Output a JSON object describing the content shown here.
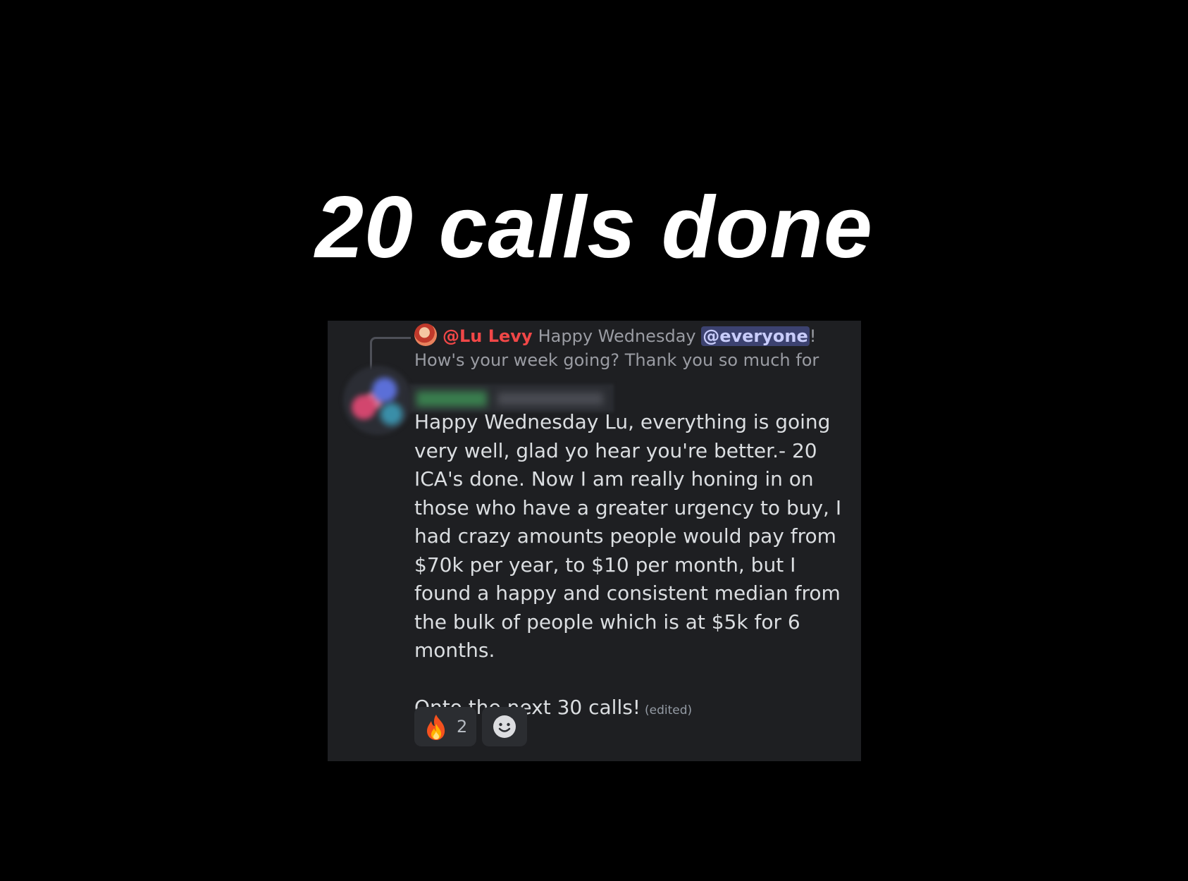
{
  "headline": "20 calls done",
  "reply": {
    "author": "@Lu Levy",
    "text_before_mention": "Happy Wednesday ",
    "mention": "@everyone",
    "text_after_mention": "! How's your week going?   Thank you so much for all the ...",
    "author_color": "#f04747"
  },
  "message": {
    "author_name_blurred": true,
    "body": "Happy Wednesday Lu, everything is going very well, glad yo hear you're better.- 20 ICA's done. Now I am really honing in on those who have a greater urgency to buy, I had crazy amounts people would pay from $70k per year, to $10 per month, but I found a happy and consistent median from the bulk of people which is at $5k for 6 months.",
    "closing": "Onto the next 30 calls!",
    "edited_label": "(edited)"
  },
  "reactions": [
    {
      "icon": "fire-icon",
      "count": "2"
    }
  ],
  "add_reaction_icon": "smiley-icon",
  "colors": {
    "background": "#000000",
    "card": "#1e1f22",
    "text": "#dbdee1",
    "mention_bg": "#3c4270"
  }
}
